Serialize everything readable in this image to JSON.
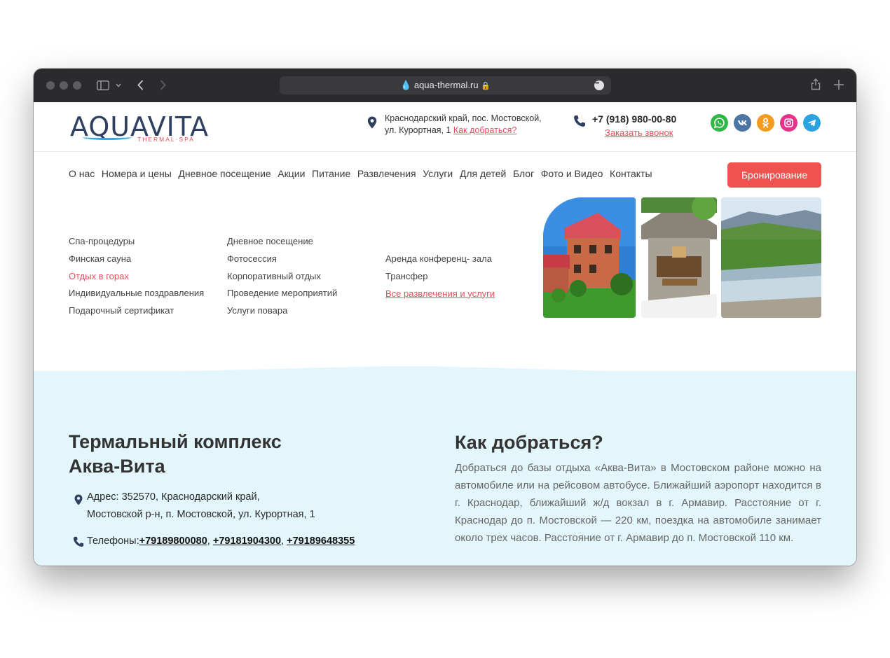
{
  "browser": {
    "url": "aqua-thermal.ru"
  },
  "header": {
    "logo_main": "AQUAVITA",
    "logo_sub": "THERMAL·SPA",
    "address_line1": "Краснодарский край, пос. Мостовской,",
    "address_line2": "ул. Курортная, 1",
    "directions_link": "Как добраться?",
    "phone": "+7 (918) 980-00-80",
    "callback": "Заказать звонок",
    "social": [
      {
        "name": "whatsapp",
        "color": "#2fb845"
      },
      {
        "name": "vk",
        "color": "#4c75a3"
      },
      {
        "name": "odnoklassniki",
        "color": "#f29b1f"
      },
      {
        "name": "instagram",
        "color": "#e6338a"
      },
      {
        "name": "telegram",
        "color": "#2aa3e0"
      }
    ]
  },
  "nav": {
    "items": [
      "О нас",
      "Номера и цены",
      "Дневное посещение",
      "Акции",
      "Питание",
      "Развлечения",
      "Услуги",
      "Для детей",
      "Блог",
      "Фото и Видео",
      "Контакты"
    ],
    "booking": "Бронирование"
  },
  "dropdown": {
    "col1": [
      "Спа-процедуры",
      "Финская сауна",
      "Отдых в горах",
      "Индивидуальные поздравления",
      "Подарочный сертификат"
    ],
    "col2": [
      "Дневное посещение",
      "Фотосессия",
      "Корпоративный отдых",
      "Проведение мероприятий",
      "Услуги повара"
    ],
    "col3": [
      "Аренда конференц- зала",
      "Трансфер",
      "Все развлечения и услуги"
    ]
  },
  "info": {
    "title_line1": "Термальный комплекс",
    "title_line2": "Аква-Вита",
    "address_label": "Адрес: 352570, Краснодарский край,",
    "address_line2": "Мостовской р-н, п. Мостовской, ул. Курортная, 1",
    "phones_label": "Телефоны:",
    "phones": [
      "+79189800080",
      "+79181904300",
      "+79189648355"
    ],
    "directions_title": "Как добраться?",
    "directions_text": "Добраться до базы отдыха «Аква-Вита» в Мостовском районе можно на автомобиле или на рейсовом автобусе. Ближайший аэропорт находится в г. Краснодар, ближайший ж/д вокзал в г. Армавир. Расстояние от г. Краснодар до п. Мостовской — 220 км, поездка на автомобиле занимает около трех часов. Расстояние от г. Армавир до п. Мостовской 110 км."
  }
}
